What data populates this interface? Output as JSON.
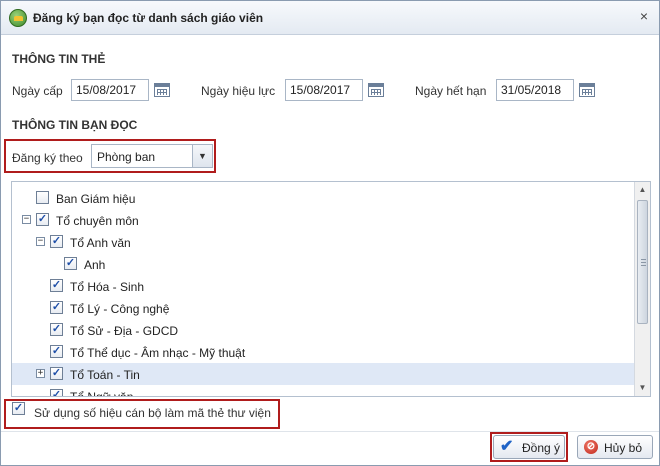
{
  "window": {
    "title": "Đăng ký bạn đọc từ danh sách giáo viên",
    "close_symbol": "×"
  },
  "card_info": {
    "section_title": "THÔNG TIN THẺ",
    "issue_date_label": "Ngày cấp",
    "issue_date_value": "15/08/2017",
    "effective_date_label": "Ngày hiệu lực",
    "effective_date_value": "15/08/2017",
    "expiry_date_label": "Ngày hết hạn",
    "expiry_date_value": "31/05/2018"
  },
  "reader_info": {
    "section_title": "THÔNG TIN BẠN ĐỌC",
    "register_by_label": "Đăng ký theo",
    "register_by_value": "Phòng ban"
  },
  "tree": {
    "nodes": [
      {
        "label": "Ban Giám hiệu",
        "checked": false,
        "expander": ""
      },
      {
        "label": "Tổ chuyên môn",
        "checked": true,
        "expander": "−"
      },
      {
        "label": "Tổ Anh văn",
        "checked": true,
        "expander": "−"
      },
      {
        "label": "Anh",
        "checked": true,
        "expander": ""
      },
      {
        "label": "Tổ Hóa - Sinh",
        "checked": true,
        "expander": ""
      },
      {
        "label": "Tổ Lý - Công nghệ",
        "checked": true,
        "expander": ""
      },
      {
        "label": "Tổ Sử - Địa - GDCD",
        "checked": true,
        "expander": ""
      },
      {
        "label": "Tổ Thể dục - Âm nhạc - Mỹ thuật",
        "checked": true,
        "expander": ""
      },
      {
        "label": "Tổ Toán - Tin",
        "checked": true,
        "expander": "+",
        "selected": true
      },
      {
        "label": "Tổ Ngữ văn",
        "checked": true,
        "expander": ""
      }
    ]
  },
  "options": {
    "use_staff_id_label": "Sử dụng số hiệu cán bộ làm mã thẻ thư viện",
    "use_staff_id_checked": true
  },
  "buttons": {
    "ok_label": "Đồng ý",
    "cancel_label": "Hủy bỏ"
  },
  "colors": {
    "highlight_border": "#b01c1c",
    "selected_row": "#dfe8f6",
    "check_accent": "#1f4fa8"
  }
}
